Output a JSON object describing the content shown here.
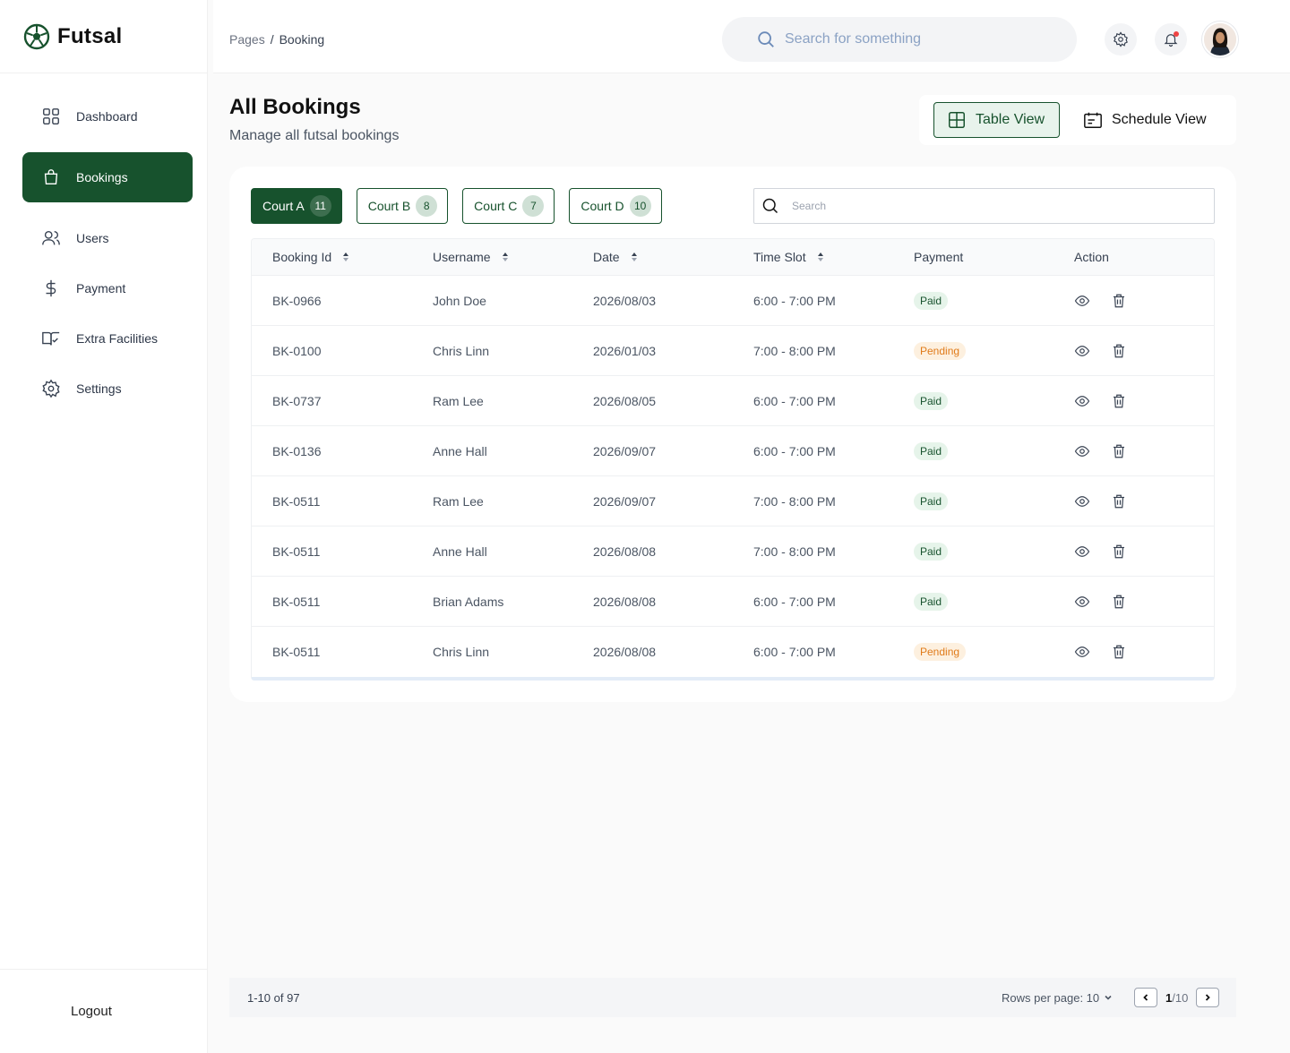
{
  "app": {
    "name": "Futsal"
  },
  "sidebar": {
    "items": [
      {
        "label": "Dashboard",
        "icon": "dashboard-icon"
      },
      {
        "label": "Bookings",
        "icon": "bag-icon",
        "active": true
      },
      {
        "label": "Users",
        "icon": "users-icon"
      },
      {
        "label": "Payment",
        "icon": "dollar-icon"
      },
      {
        "label": "Extra Facilities",
        "icon": "book-check-icon"
      },
      {
        "label": "Settings",
        "icon": "gear-icon"
      }
    ],
    "logout": "Logout"
  },
  "header": {
    "breadcrumb": {
      "root": "Pages",
      "separator": "/",
      "current": "Booking"
    },
    "search_placeholder": "Search for something"
  },
  "page": {
    "title": "All Bookings",
    "subtitle": "Manage all futsal bookings",
    "views": {
      "table": "Table View",
      "schedule": "Schedule View"
    }
  },
  "courts": [
    {
      "label": "Court A",
      "count": "11",
      "active": true
    },
    {
      "label": "Court B",
      "count": "8"
    },
    {
      "label": "Court C",
      "count": "7"
    },
    {
      "label": "Court D",
      "count": "10"
    }
  ],
  "table": {
    "search_placeholder": "Search",
    "columns": [
      "Booking Id",
      "Username",
      "Date",
      "Time Slot",
      "Payment",
      "Action"
    ],
    "rows": [
      {
        "id": "BK-0966",
        "user": "John Doe",
        "date": "2026/08/03",
        "slot": "6:00 - 7:00 PM",
        "payment": "Paid"
      },
      {
        "id": "BK-0100",
        "user": "Chris Linn",
        "date": "2026/01/03",
        "slot": "7:00 - 8:00 PM",
        "payment": "Pending"
      },
      {
        "id": "BK-0737",
        "user": "Ram Lee",
        "date": "2026/08/05",
        "slot": "6:00 - 7:00 PM",
        "payment": "Paid"
      },
      {
        "id": "BK-0136",
        "user": "Anne Hall",
        "date": "2026/09/07",
        "slot": "6:00 - 7:00 PM",
        "payment": "Paid"
      },
      {
        "id": "BK-0511",
        "user": "Ram Lee",
        "date": "2026/09/07",
        "slot": "7:00 - 8:00 PM",
        "payment": "Paid"
      },
      {
        "id": "BK-0511",
        "user": "Anne Hall",
        "date": "2026/08/08",
        "slot": "7:00 - 8:00 PM",
        "payment": "Paid"
      },
      {
        "id": "BK-0511",
        "user": "Brian Adams",
        "date": "2026/08/08",
        "slot": "6:00 - 7:00 PM",
        "payment": "Paid"
      },
      {
        "id": "BK-0511",
        "user": "Chris Linn",
        "date": "2026/08/08",
        "slot": "6:00 - 7:00 PM",
        "payment": "Pending"
      }
    ]
  },
  "pagination": {
    "range": "1-10 of 97",
    "rows_per_page": "Rows per page: 10",
    "current": "1",
    "total": "/10"
  },
  "colors": {
    "primary": "#17522d",
    "paid_bg": "#e6f4ea",
    "pending_bg": "#fdf0df",
    "pending_text": "#e07b1a"
  }
}
